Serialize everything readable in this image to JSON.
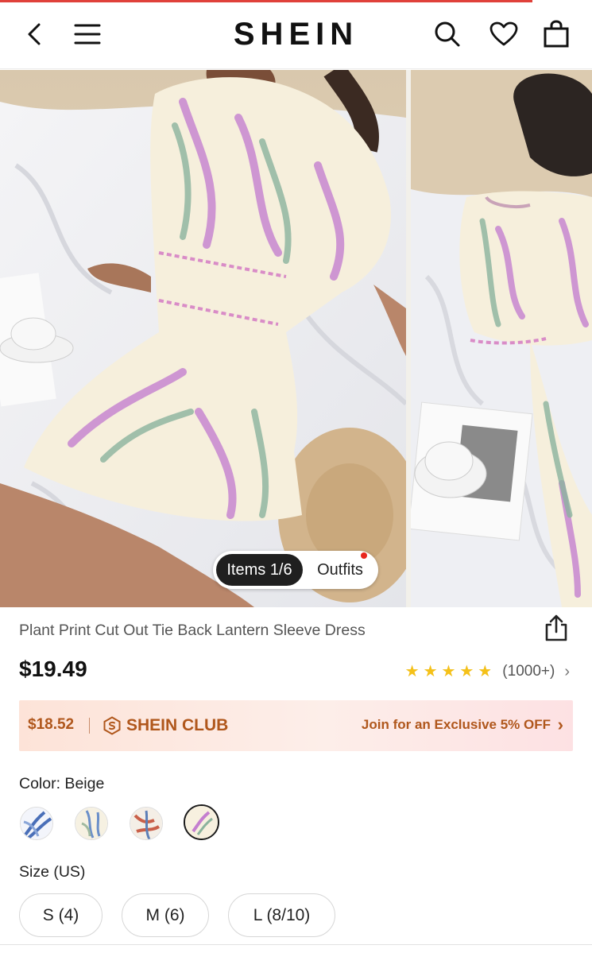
{
  "header": {
    "logo": "SHEIN",
    "icons": [
      "back-icon",
      "menu-icon",
      "search-icon",
      "heart-icon",
      "bag-icon"
    ]
  },
  "gallery": {
    "counter_label": "Items 1/6",
    "outfits_label": "Outfits"
  },
  "product": {
    "title": "Plant Print Cut Out Tie Back Lantern Sleeve Dress",
    "price": "$19.49",
    "rating_stars": 4.7,
    "review_count": "(1000+)"
  },
  "club": {
    "price": "$18.52",
    "name": "SHEIN CLUB",
    "cta": "Join for an Exclusive 5% OFF"
  },
  "color": {
    "label": "Color: Beige",
    "selected_index": 3
  },
  "size": {
    "label": "Size (US)",
    "options": [
      "S (4)",
      "M (6)",
      "L (8/10)"
    ]
  },
  "colors": {
    "accent_red": "#e0413a",
    "club_text": "#b0571c",
    "star": "#f5c118"
  }
}
